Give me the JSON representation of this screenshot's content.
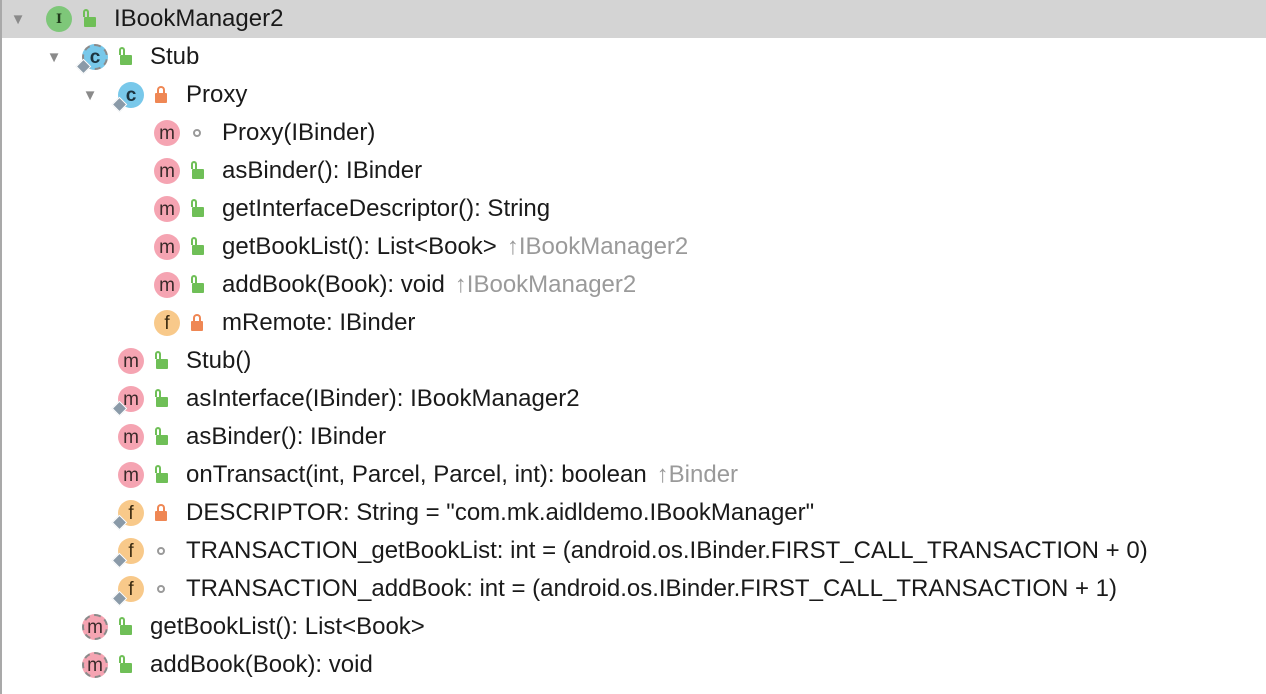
{
  "tree": {
    "rows": [
      {
        "name": "IBookManager2",
        "kind": "interface",
        "icon_letter": "I",
        "visibility": "public",
        "expanded": true,
        "selected": true
      },
      {
        "name": "Stub",
        "kind": "abstract-class",
        "icon_letter": "c",
        "visibility": "public",
        "expanded": true,
        "static": true
      },
      {
        "name": "Proxy",
        "kind": "class",
        "icon_letter": "c",
        "visibility": "private",
        "expanded": true,
        "static": true
      },
      {
        "name": "Proxy(IBinder)",
        "kind": "method",
        "icon_letter": "m",
        "visibility": "package"
      },
      {
        "name": "asBinder(): IBinder",
        "kind": "method",
        "icon_letter": "m",
        "visibility": "public"
      },
      {
        "name": "getInterfaceDescriptor(): String",
        "kind": "method",
        "icon_letter": "m",
        "visibility": "public"
      },
      {
        "name": "getBookList(): List<Book>",
        "kind": "method",
        "icon_letter": "m",
        "visibility": "public",
        "inherited_from": "↑IBookManager2"
      },
      {
        "name": "addBook(Book): void",
        "kind": "method",
        "icon_letter": "m",
        "visibility": "public",
        "inherited_from": "↑IBookManager2"
      },
      {
        "name": "mRemote: IBinder",
        "kind": "field",
        "icon_letter": "f",
        "visibility": "private"
      },
      {
        "name": "Stub()",
        "kind": "method",
        "icon_letter": "m",
        "visibility": "public"
      },
      {
        "name": "asInterface(IBinder): IBookManager2",
        "kind": "method",
        "icon_letter": "m",
        "visibility": "public",
        "static": true
      },
      {
        "name": "asBinder(): IBinder",
        "kind": "method",
        "icon_letter": "m",
        "visibility": "public"
      },
      {
        "name": "onTransact(int, Parcel, Parcel, int): boolean",
        "kind": "method",
        "icon_letter": "m",
        "visibility": "public",
        "inherited_from": "↑Binder"
      },
      {
        "name": "DESCRIPTOR: String = \"com.mk.aidldemo.IBookManager\"",
        "kind": "field",
        "icon_letter": "f",
        "visibility": "private",
        "static": true
      },
      {
        "name": "TRANSACTION_getBookList: int = (android.os.IBinder.FIRST_CALL_TRANSACTION + 0)",
        "kind": "field",
        "icon_letter": "f",
        "visibility": "package",
        "static": true
      },
      {
        "name": "TRANSACTION_addBook: int = (android.os.IBinder.FIRST_CALL_TRANSACTION + 1)",
        "kind": "field",
        "icon_letter": "f",
        "visibility": "package",
        "static": true
      },
      {
        "name": "getBookList(): List<Book>",
        "kind": "abstract-method",
        "icon_letter": "m",
        "visibility": "public"
      },
      {
        "name": "addBook(Book): void",
        "kind": "abstract-method",
        "icon_letter": "m",
        "visibility": "public"
      }
    ]
  }
}
